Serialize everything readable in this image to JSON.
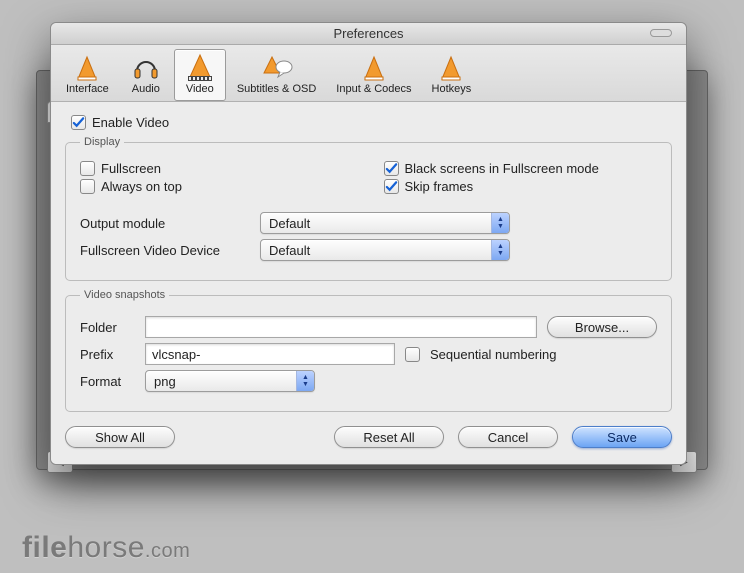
{
  "window": {
    "title": "Preferences"
  },
  "toolbar": {
    "items": [
      {
        "label": "Interface",
        "icon": "cone"
      },
      {
        "label": "Audio",
        "icon": "headphones"
      },
      {
        "label": "Video",
        "icon": "film"
      },
      {
        "label": "Subtitles & OSD",
        "icon": "speech"
      },
      {
        "label": "Input & Codecs",
        "icon": "cone"
      },
      {
        "label": "Hotkeys",
        "icon": "cone"
      }
    ],
    "selected": 2
  },
  "video": {
    "enable": {
      "label": "Enable Video",
      "checked": true
    },
    "display": {
      "legend": "Display",
      "fullscreen": {
        "label": "Fullscreen",
        "checked": false
      },
      "black_screens": {
        "label": "Black screens in Fullscreen mode",
        "checked": true
      },
      "always_on_top": {
        "label": "Always on top",
        "checked": false
      },
      "skip_frames": {
        "label": "Skip frames",
        "checked": true
      },
      "output_module": {
        "label": "Output module",
        "value": "Default"
      },
      "fs_device": {
        "label": "Fullscreen Video Device",
        "value": "Default"
      }
    },
    "snapshots": {
      "legend": "Video snapshots",
      "folder": {
        "label": "Folder",
        "value": "",
        "browse": "Browse..."
      },
      "prefix": {
        "label": "Prefix",
        "value": "vlcsnap-"
      },
      "sequential": {
        "label": "Sequential numbering",
        "checked": false
      },
      "format": {
        "label": "Format",
        "value": "png"
      }
    }
  },
  "buttons": {
    "show_all": "Show All",
    "reset_all": "Reset All",
    "cancel": "Cancel",
    "save": "Save"
  },
  "watermark": {
    "brand": "file",
    "rest": "horse",
    "tld": ".com"
  }
}
